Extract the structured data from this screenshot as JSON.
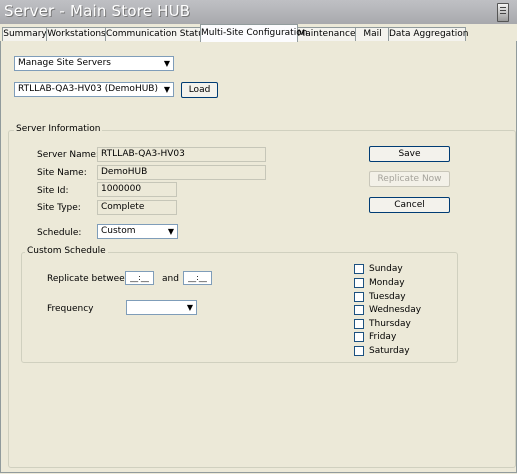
{
  "window": {
    "title": "Server - Main Store HUB"
  },
  "tabs": [
    {
      "label": "Summary"
    },
    {
      "label": "Workstations"
    },
    {
      "label": "Communication Status"
    },
    {
      "label": "Multi-Site Configuration"
    },
    {
      "label": "Maintenance"
    },
    {
      "label": "Mail"
    },
    {
      "label": "Data Aggregation"
    }
  ],
  "controls": {
    "mode_select": "Manage Site Servers",
    "server_select": "RTLLAB-QA3-HV03 (DemoHUB)",
    "load_button": "Load"
  },
  "server_info": {
    "group_label": "Server Information",
    "server_name_label": "Server Name:",
    "server_name": "RTLLAB-QA3-HV03",
    "site_name_label": "Site Name:",
    "site_name": "DemoHUB",
    "site_id_label": "Site Id:",
    "site_id": "1000000",
    "site_type_label": "Site Type:",
    "site_type": "Complete",
    "schedule_label": "Schedule:",
    "schedule": "Custom"
  },
  "buttons": {
    "save": "Save",
    "replicate_now": "Replicate Now",
    "cancel": "Cancel"
  },
  "custom_schedule": {
    "group_label": "Custom Schedule",
    "replicate_between_label": "Replicate between",
    "start_time": "__:__",
    "and_label": "and",
    "end_time": "__:__",
    "frequency_label": "Frequency",
    "frequency": "",
    "days": [
      "Sunday",
      "Monday",
      "Tuesday",
      "Wednesday",
      "Thursday",
      "Friday",
      "Saturday"
    ]
  }
}
